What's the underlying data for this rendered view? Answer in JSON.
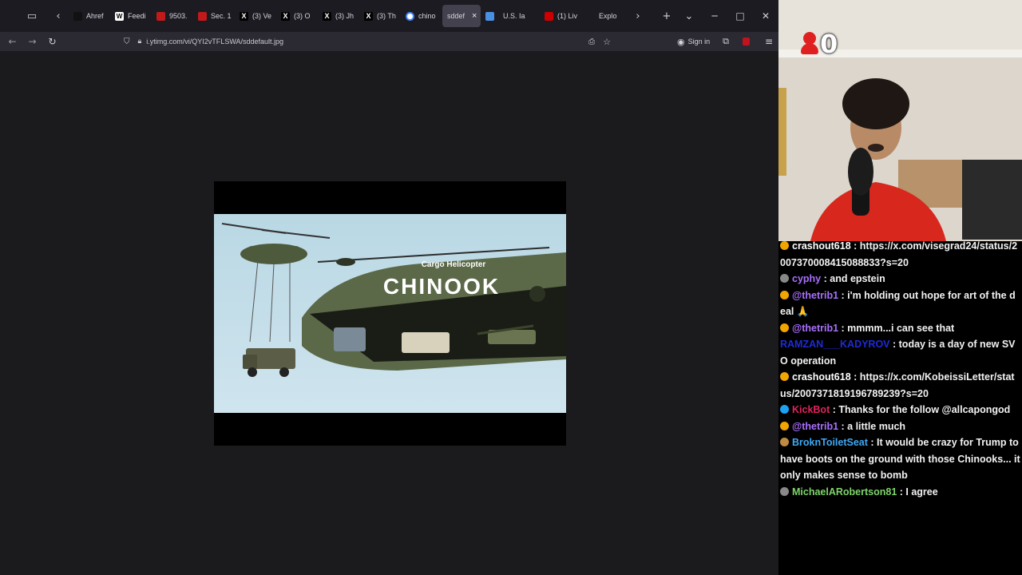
{
  "browser": {
    "tabs": [
      {
        "label": "Ahref",
        "favicon": "tiktok-icon",
        "color": "#111111"
      },
      {
        "label": "Feedi",
        "favicon": "wikipedia-icon",
        "color": "#ffffff"
      },
      {
        "label": "9503.",
        "favicon": "red-page-icon",
        "color": "#c21a1a"
      },
      {
        "label": "Sec. 1",
        "favicon": "red-page-icon",
        "color": "#c21a1a"
      },
      {
        "label": "(3) Ve",
        "favicon": "x-icon",
        "color": "#000000"
      },
      {
        "label": "(3) O",
        "favicon": "x-icon",
        "color": "#000000"
      },
      {
        "label": "(3) Jh",
        "favicon": "x-icon",
        "color": "#000000"
      },
      {
        "label": "(3) Th",
        "favicon": "x-icon",
        "color": "#000000"
      },
      {
        "label": "chino",
        "favicon": "google-icon",
        "color": "#4285f4"
      },
      {
        "label": "sddef",
        "favicon": "",
        "color": "#42414d",
        "active": true
      },
      {
        "label": "",
        "favicon": "blue-square-icon",
        "color": "#4a90e2"
      },
      {
        "label": "U.S. Ia",
        "favicon": "",
        "color": "#1c1b22"
      },
      {
        "label": "(1) Liv",
        "favicon": "cnn-icon",
        "color": "#cc0000"
      },
      {
        "label": "Explo",
        "favicon": "wp-icon",
        "color": "#1c1b22"
      }
    ],
    "url": "i.ytimg.com/vi/QYI2vTFLSWA/sddefault.jpg",
    "sign_in_label": "Sign in",
    "close_glyph": "×"
  },
  "image": {
    "heading_small": "Cargo Helicopter",
    "heading_big": "CHINOOK"
  },
  "stream": {
    "viewer_count": "0",
    "chat": [
      {
        "user": "crashout618",
        "user_color": "#ffffff",
        "badge": "#f0a500",
        "text": "https://x.com/visegrad24/status/2007370008415088833?s=20"
      },
      {
        "user": "cyphy",
        "user_color": "#a970ff",
        "badge": "#888888",
        "text": "and epstein"
      },
      {
        "user": "@thetrib1",
        "user_color": "#a970ff",
        "badge": "#f0a500",
        "text": "i'm holding out hope for art of the deal 🙏"
      },
      {
        "user": "@thetrib1",
        "user_color": "#a970ff",
        "badge": "#f0a500",
        "text": "mmmm...i can see that"
      },
      {
        "user": "RAMZAN___KADYROV",
        "user_color": "#1e2bd8",
        "badge": "",
        "text": "today is a day of new SVO operation"
      },
      {
        "user": "crashout618",
        "user_color": "#ffffff",
        "badge": "#f0a500",
        "text": "https://x.com/KobeissiLetter/status/2007371819196789239?s=20"
      },
      {
        "user": "KickBot",
        "user_color": "#e0245e",
        "badge": "#1da1f2",
        "text": "Thanks for the follow @allcapongod"
      },
      {
        "user": "@thetrib1",
        "user_color": "#a970ff",
        "badge": "#f0a500",
        "text": "a little much"
      },
      {
        "user": "BroknToiletSeat",
        "user_color": "#3fa9f5",
        "badge": "#c08a40",
        "text": "It would be crazy for Trump to have boots on the ground with those Chinooks... it only makes sense to bomb"
      },
      {
        "user": "MichaelARobertson81",
        "user_color": "#7fd46b",
        "badge": "#888888",
        "text": "I agree"
      }
    ]
  }
}
